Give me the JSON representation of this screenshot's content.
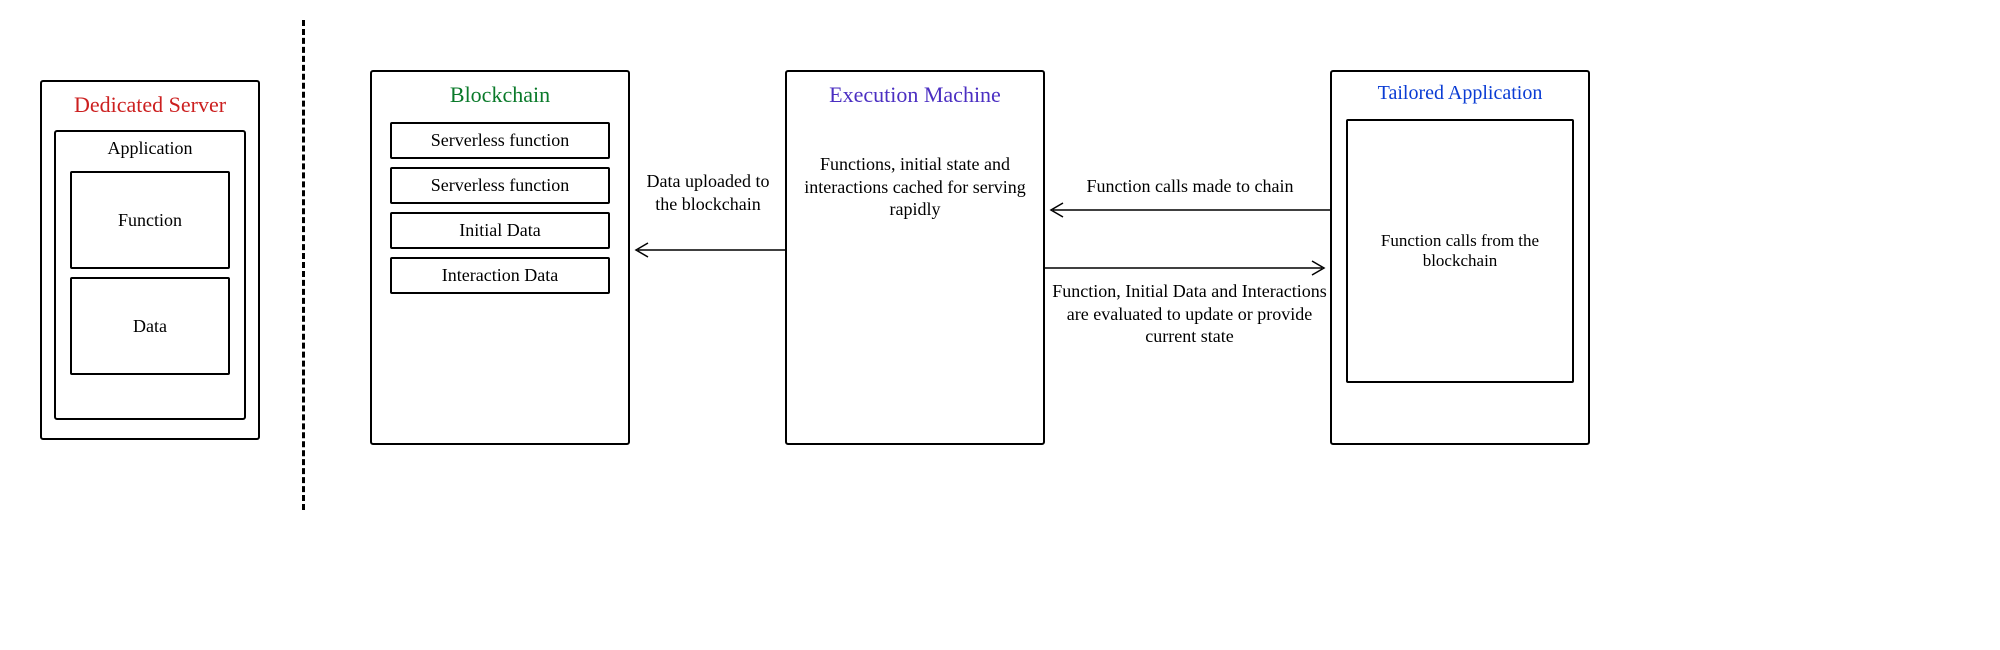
{
  "dedicated_server": {
    "title": "Dedicated Server",
    "application_label": "Application",
    "function_label": "Function",
    "data_label": "Data"
  },
  "blockchain": {
    "title": "Blockchain",
    "items": [
      "Serverless function",
      "Serverless function",
      "Initial Data",
      "Interaction Data"
    ]
  },
  "execution_machine": {
    "title": "Execution Machine",
    "body": "Functions, initial state and interactions cached for serving rapidly"
  },
  "tailored_app": {
    "title": "Tailored Application",
    "body": "Function calls from the blockchain"
  },
  "arrows": {
    "data_uploaded": "Data uploaded to the blockchain",
    "calls_to_chain": "Function calls made to chain",
    "evaluated": "Function, Initial Data and Interactions are evaluated to update or provide current state"
  }
}
